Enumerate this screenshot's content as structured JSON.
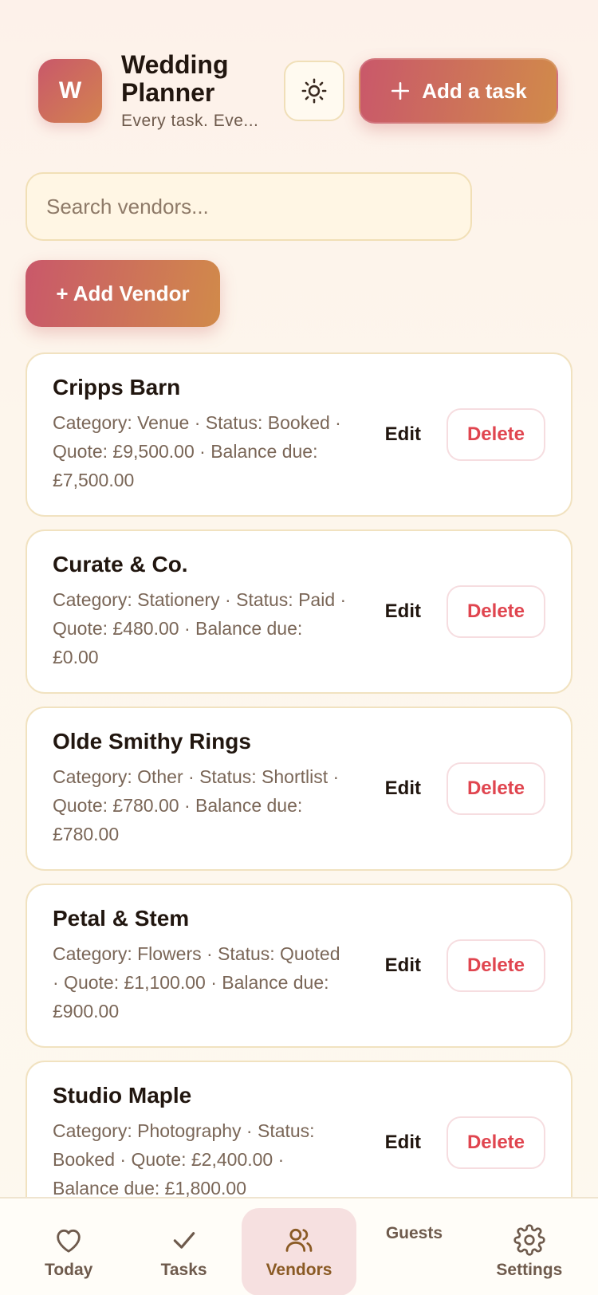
{
  "header": {
    "logo_letter": "W",
    "title": "Wedding Planner",
    "subtitle": "Every task. Eve...",
    "theme_icon": "sun-icon",
    "add_task_label": "Add a task"
  },
  "search": {
    "placeholder": "Search vendors..."
  },
  "add_vendor_label": "+ Add Vendor",
  "vendors": [
    {
      "name": "Cripps Barn",
      "meta": "Category: Venue · Status: Booked · Quote: £9,500.00 · Balance due: £7,500.00",
      "edit": "Edit",
      "delete": "Delete"
    },
    {
      "name": "Curate & Co.",
      "meta": "Category: Stationery · Status: Paid · Quote: £480.00 · Balance due: £0.00",
      "edit": "Edit",
      "delete": "Delete"
    },
    {
      "name": "Olde Smithy Rings",
      "meta": "Category: Other · Status: Shortlist · Quote: £780.00 · Balance due: £780.00",
      "edit": "Edit",
      "delete": "Delete"
    },
    {
      "name": "Petal & Stem",
      "meta": "Category: Flowers · Status: Quoted · Quote: £1,100.00 · Balance due: £900.00",
      "edit": "Edit",
      "delete": "Delete"
    },
    {
      "name": "Studio Maple",
      "meta": "Category: Photography · Status: Booked · Quote: £2,400.00 · Balance due: £1,800.00",
      "edit": "Edit",
      "delete": "Delete"
    }
  ],
  "nav": {
    "today": "Today",
    "tasks": "Tasks",
    "vendors": "Vendors",
    "guests": "Guests",
    "settings": "Settings"
  },
  "colors": {
    "accent_start": "#c9586a",
    "accent_end": "#d18a4a",
    "danger": "#e0454f",
    "active_nav_bg": "#f6e0e0"
  }
}
